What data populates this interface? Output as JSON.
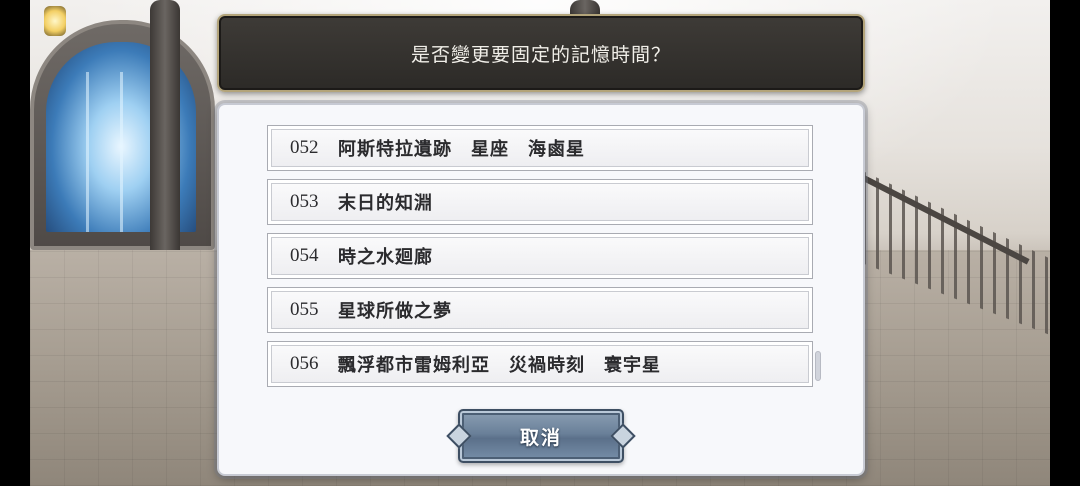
{
  "dialog": {
    "title": "是否變更要固定的記憶時間？",
    "items": [
      {
        "number": "052",
        "name": "阿斯特拉遺跡　星座　海鹵星"
      },
      {
        "number": "053",
        "name": "末日的知淵"
      },
      {
        "number": "054",
        "name": "時之水廻廊"
      },
      {
        "number": "055",
        "name": "星球所做之夢"
      },
      {
        "number": "056",
        "name": "飄浮都市雷姆利亞　災禍時刻　寰宇星"
      }
    ],
    "cancel_label": "取消"
  },
  "colors": {
    "title_bar": "#2c2a27",
    "title_border": "#b3a47a",
    "dialog_bg": "#f7f8fb",
    "button_accent": "#6a8099"
  },
  "icons": {
    "scrollbar": "scrollbar-thumb"
  }
}
